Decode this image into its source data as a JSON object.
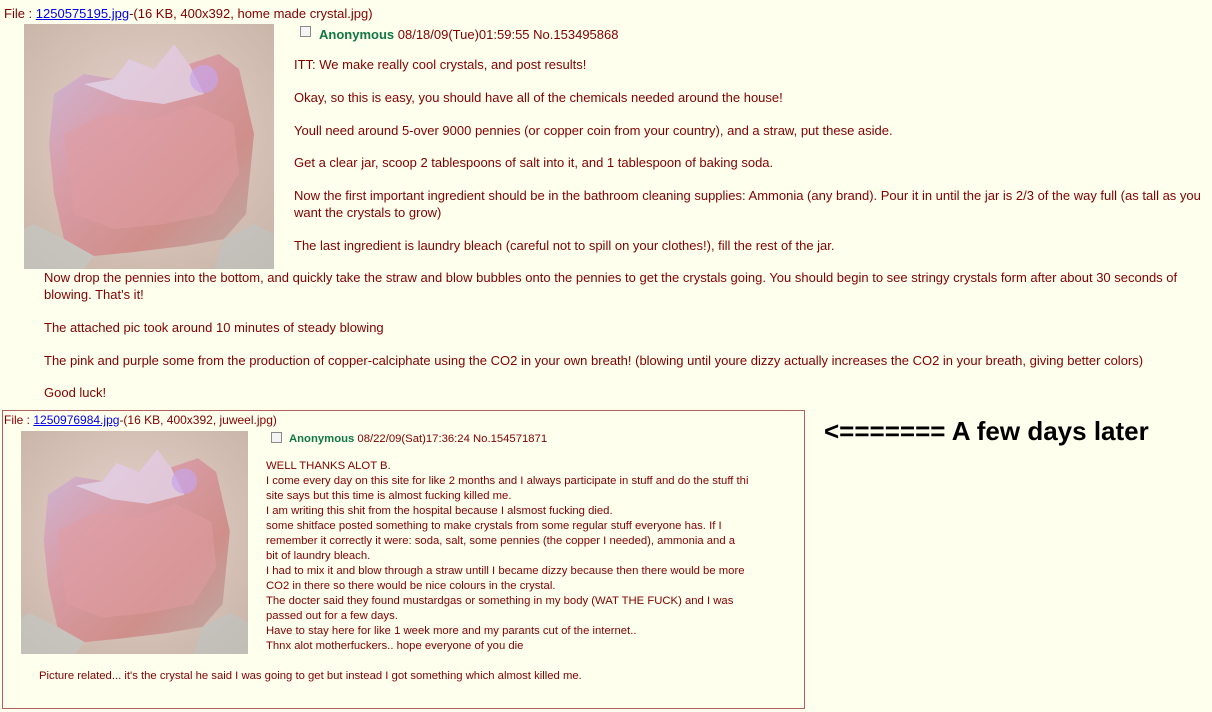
{
  "op": {
    "file_prefix": "File : ",
    "file_name": "1250575195.jpg",
    "file_info": "-(16 KB, 400x392, home made crystal.jpg)",
    "poster": "Anonymous",
    "datetime": "08/18/09(Tue)01:59:55",
    "post_no": "No.153495868",
    "paragraphs": [
      "ITT: We make really cool crystals, and post results!",
      "Okay, so this is easy, you should have all of the chemicals needed around the house!",
      "Youll need around 5-over 9000 pennies (or copper coin from your country), and a straw, put these aside.",
      "Get a clear jar, scoop 2 tablespoons of salt into it, and 1 tablespoon of baking soda.",
      "Now the first important ingredient should be in the bathroom cleaning supplies: Ammonia (any brand). Pour it in until the jar is 2/3 of the way full (as tall as you want the crystals to grow)",
      "The last ingredient is laundry bleach (careful not to spill on your clothes!), fill the rest of the jar.",
      "Now drop the pennies into the bottom, and quickly take the straw and blow bubbles onto the pennies to get the crystals going. You should begin to see stringy crystals form after about 30 seconds of blowing. That's it!",
      "The attached pic took around 10 minutes of steady blowing",
      "The pink and purple some from the production of copper-calciphate using the CO2 in your own breath! (blowing until youre dizzy actually increases the CO2 in your breath, giving better colors)",
      "Good luck!"
    ]
  },
  "reply": {
    "file_prefix": "File : ",
    "file_name": "1250976984.jpg",
    "file_info": "-(16 KB, 400x392, juweel.jpg)",
    "poster": "Anonymous",
    "datetime": "08/22/09(Sat)17:36:24",
    "post_no": "No.154571871",
    "lines": [
      "WELL THANKS ALOT B.",
      "I come every day on this site for like 2 months and I always participate in stuff and do the stuff thi",
      "site says but this time is almost fucking killed me.",
      "I am writing this shit from the hospital because I alsmost fucking died.",
      "some shitface posted something to make crystals from some regular stuff everyone has. If I",
      "remember it correctly it were: soda, salt, some pennies (the copper I needed), ammonia and a",
      "bit of laundry bleach.",
      "I had to mix it and blow through a straw untill I became dizzy because then there would be more",
      "CO2 in there so there would be nice colours in the crystal.",
      "The docter said they found mustardgas or something in my body (WAT THE FUCK) and I was",
      "passed out for a few days.",
      "Have to stay here for like 1 week more and my parants cut of the internet..",
      "Thnx alot motherfuckers.. hope everyone of you die"
    ],
    "footer": "Picture related... it's the crystal he said I was going to get but instead I got something which almost killed me."
  },
  "annotation": "<======= A few days later"
}
